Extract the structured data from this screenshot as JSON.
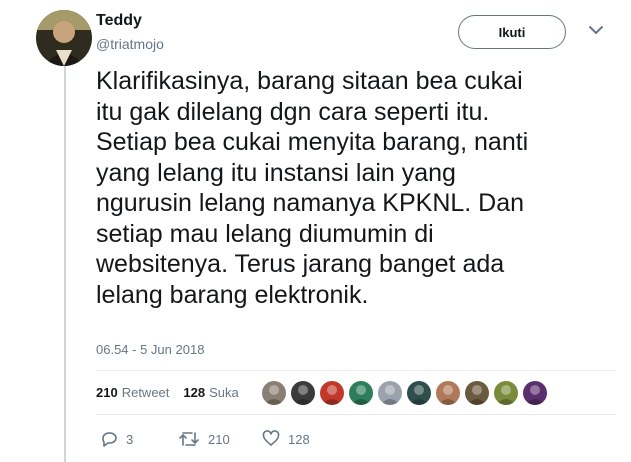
{
  "user": {
    "name": "Teddy",
    "handle": "@triatmojo"
  },
  "follow_label": "Ikuti",
  "tweet_lines": [
    "Klarifikasinya, barang sitaan bea cukai",
    "itu gak dilelang dgn cara seperti itu.",
    "Setiap bea cukai menyita barang, nanti",
    "yang lelang itu instansi lain yang",
    "ngurusin lelang namanya KPKNL. Dan",
    "setiap mau lelang diumumin di",
    "websitenya. Terus jarang banget ada",
    "lelang barang elektronik."
  ],
  "timestamp": "06.54 - 5 Jun 2018",
  "stats": {
    "retweet_count": "210",
    "retweet_label": "Retweet",
    "like_count": "128",
    "like_label": "Suka"
  },
  "liker_avatars": [
    "#8a7f73",
    "#3b3b3b",
    "#c0392b",
    "#2e7d5b",
    "#9aa3ad",
    "#2f4f4f",
    "#b07a5a",
    "#6b5a3e",
    "#7b8b3a",
    "#5a2f6b"
  ],
  "actions": {
    "reply_count": "3",
    "retweet_count": "210",
    "like_count": "128"
  },
  "colors": {
    "text": "#14171a",
    "muted": "#657786",
    "divider": "#e6ecf0",
    "thread": "#ccd6dd"
  }
}
